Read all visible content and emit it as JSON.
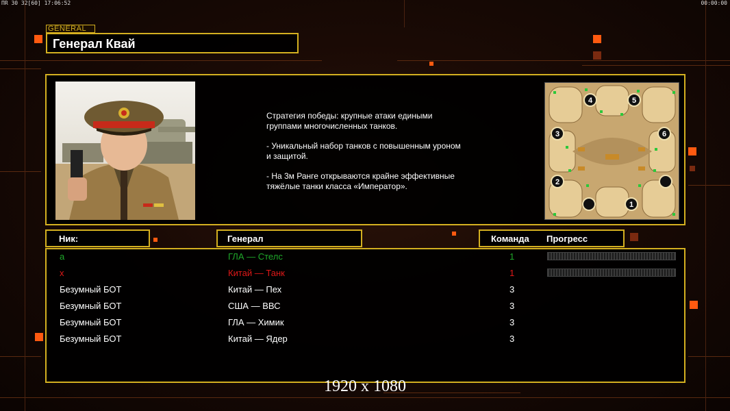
{
  "hud": {
    "left": "ПR 30 32[60] 17:06:52",
    "right": "00:00:00"
  },
  "general": {
    "tag": "GENERAL",
    "name": "Генерал Квай"
  },
  "description": {
    "p1": "Стратегия победы: крупные атаки едиными\n группами многочисленных танков.",
    "p2": "- Уникальный набор танков с повышенным уроном\n и защитой.",
    "p3": "- На 3м Ранге открываются крайне эффективные\n тяжёлые танки класса «Император»."
  },
  "map": {
    "slots": [
      "1",
      "2",
      "3",
      "4",
      "5",
      "6"
    ]
  },
  "table": {
    "col_nick": "Ник:",
    "col_general": "Генерал",
    "col_team": "Команда",
    "col_progress": "Прогресс",
    "rows": [
      {
        "nick": "а",
        "general": "ГЛА — Стелс",
        "team": "1",
        "color": "#1fa82a",
        "progress": true
      },
      {
        "nick": "x",
        "general": "Китай — Танк",
        "team": "1",
        "color": "#e01818",
        "progress": true
      },
      {
        "nick": "Безумный БОТ",
        "general": "Китай — Пех",
        "team": "3",
        "color": "#ffffff",
        "progress": false
      },
      {
        "nick": "Безумный БОТ",
        "general": "США — ВВС",
        "team": "3",
        "color": "#ffffff",
        "progress": false
      },
      {
        "nick": "Безумный БОТ",
        "general": "ГЛА — Химик",
        "team": "3",
        "color": "#ffffff",
        "progress": false
      },
      {
        "nick": "Безумный БОТ",
        "general": "Китай — Ядер",
        "team": "3",
        "color": "#ffffff",
        "progress": false
      }
    ]
  },
  "resolution": "1920 x 1080",
  "colors": {
    "frame": "#d4b020",
    "accent": "#ff5a10"
  }
}
